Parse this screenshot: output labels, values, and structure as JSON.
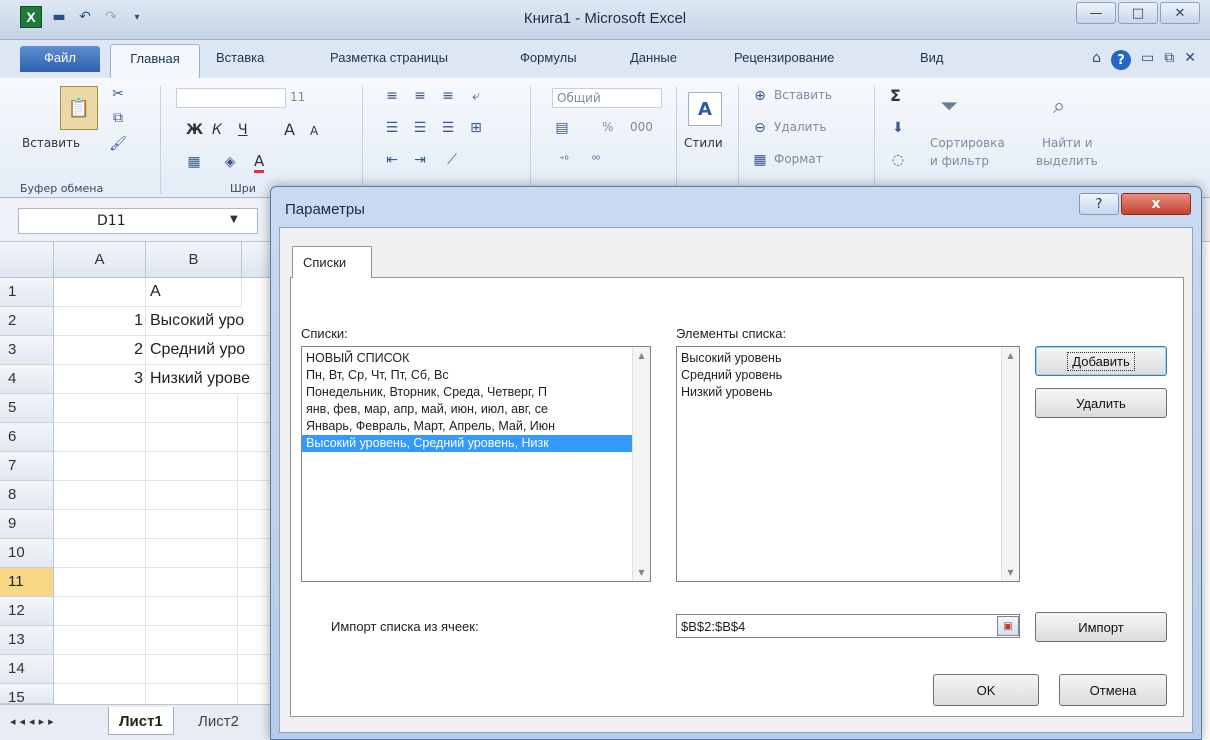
{
  "window": {
    "title": "Книга1  -  Microsoft Excel",
    "logo_letter": "X"
  },
  "ribbon_tabs": {
    "file": "Файл",
    "home": "Главная",
    "insert": "Вставка",
    "page_layout": "Разметка страницы",
    "formulas": "Формулы",
    "data": "Данные",
    "review": "Рецензирование",
    "view": "Вид"
  },
  "ribbon": {
    "paste": "Вставить",
    "font_size": "11",
    "bold": "Ж",
    "italic": "К",
    "underline": "Ч",
    "grow_font": "A",
    "shrink_font": "A",
    "font_color": "A",
    "number_format": "Общий",
    "percent": "%",
    "thousands": "000",
    "styles": "Стили",
    "insert_cells": "Вставить",
    "delete_cells": "Удалить",
    "format_cells": "Формат",
    "sigma": "Σ",
    "sort_line1": "Сортировка",
    "sort_line2": "и фильтр",
    "find_line1": "Найти и",
    "find_line2": "выделить",
    "clipboard_group": "Буфер обмена",
    "font_group": "Шри"
  },
  "formula_bar": {
    "name_box": "D11"
  },
  "sheet": {
    "columns": [
      "A",
      "B"
    ],
    "rows": [
      "1",
      "2",
      "3",
      "4",
      "5",
      "6",
      "7",
      "8",
      "9",
      "10",
      "11",
      "12",
      "13",
      "14",
      "15"
    ],
    "selected_row": "11",
    "cells": {
      "b1": "А",
      "a2": "1",
      "b2": "Высокий уро",
      "a3": "2",
      "b3": "Средний урo",
      "a4": "3",
      "b4": "Низкий урове"
    },
    "tabs": [
      "Лист1",
      "Лист2"
    ]
  },
  "dialog": {
    "title": "Параметры",
    "help": "?",
    "close": "x",
    "tab": "Списки",
    "lists_label": "Списки:",
    "lists": [
      "НОВЫЙ СПИСОК",
      "Пн, Вт, Ср, Чт, Пт, Сб, Вс",
      "Понедельник, Вторник, Среда, Четверг, П",
      "янв, фев, мар, апр, май, июн, июл, авг, се",
      "Январь, Февраль, Март, Апрель, Май, Июн",
      "Высокий уровень, Средний уровень, Низк"
    ],
    "selected_list_index": 5,
    "entries_label": "Элементы списка:",
    "entries": [
      "Высокий уровень",
      "Средний уровень",
      "Низкий уровень"
    ],
    "add_button": "Добавить",
    "delete_button": "Удалить",
    "import_label": "Импорт списка из ячеек:",
    "import_range": "$B$2:$B$4",
    "import_button": "Импорт",
    "ok_button": "OK",
    "cancel_button": "Отмена"
  },
  "colors": {
    "selected_list": "#3399ff",
    "selected_row_header": "#f7d784",
    "file_tab": "#2d5fae"
  }
}
